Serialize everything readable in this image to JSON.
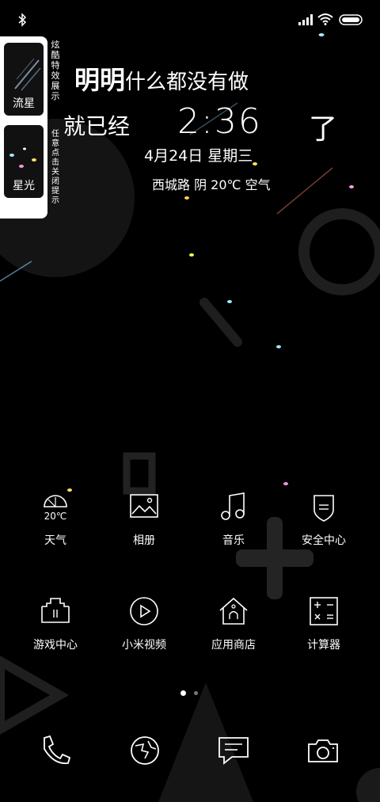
{
  "status_bar": {
    "icons": [
      "bluetooth-icon",
      "signal-icon",
      "wifi-icon",
      "battery-icon"
    ]
  },
  "effect_panel": {
    "title": "炫酷特效展示",
    "hint": "任意点击关闭提示",
    "items": [
      {
        "label": "流星"
      },
      {
        "label": "星光"
      }
    ]
  },
  "widget": {
    "line1_big": "明明",
    "line1_rest": "什么都没有做",
    "line2_prefix": "就已经",
    "time": "2:36",
    "line2_suffix": "了",
    "date": "4月24日 星期三",
    "weather": "西城路 阴 20℃ 空气"
  },
  "apps": [
    {
      "label": "天气",
      "icon": "weather-icon",
      "icon_text": "20℃"
    },
    {
      "label": "相册",
      "icon": "gallery-icon"
    },
    {
      "label": "音乐",
      "icon": "music-icon"
    },
    {
      "label": "安全中心",
      "icon": "security-icon"
    },
    {
      "label": "游戏中心",
      "icon": "game-center-icon"
    },
    {
      "label": "小米视频",
      "icon": "video-icon"
    },
    {
      "label": "应用商店",
      "icon": "app-store-icon"
    },
    {
      "label": "计算器",
      "icon": "calculator-icon"
    }
  ],
  "page_indicator": {
    "count": 2,
    "active": 1
  },
  "dock": [
    {
      "icon": "phone-icon"
    },
    {
      "icon": "browser-icon"
    },
    {
      "icon": "messages-icon"
    },
    {
      "icon": "camera-icon"
    }
  ],
  "colors": {
    "background": "#000000",
    "foreground": "#ffffff",
    "shape": "#1c1c1c"
  }
}
